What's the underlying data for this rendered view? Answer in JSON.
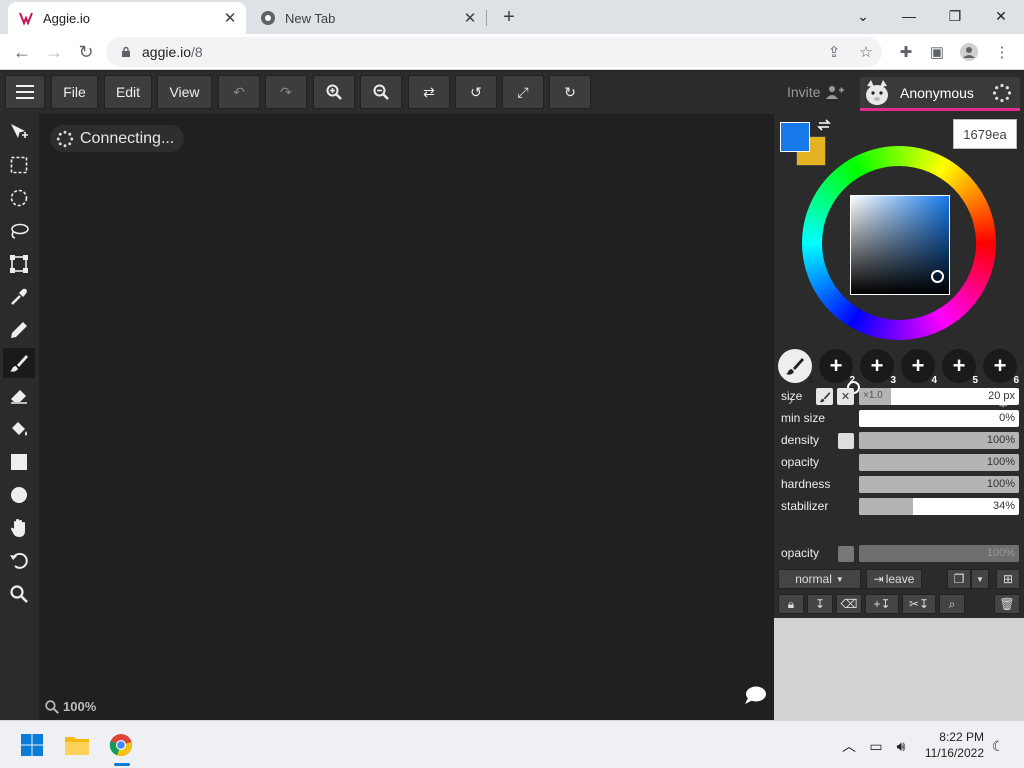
{
  "browser": {
    "tabs": [
      {
        "title": "Aggie.io"
      },
      {
        "title": "New Tab"
      }
    ],
    "url_host": "aggie.io",
    "url_path": "/8"
  },
  "menu": {
    "file": "File",
    "edit": "Edit",
    "view": "View",
    "invite": "Invite",
    "username": "Anonymous"
  },
  "canvas": {
    "status": "Connecting...",
    "zoom": "100%"
  },
  "color": {
    "primary": "#1679ea",
    "secondary": "#e5b321",
    "hex": "1679ea"
  },
  "brushes": [
    "1",
    "2",
    "3",
    "4",
    "5",
    "6"
  ],
  "brush_settings": {
    "size_label": "size",
    "size_multiplier": "×1.0",
    "size_value": "20 px",
    "size_level": 0.2,
    "min_size_label": "min size",
    "min_size_value": "0%",
    "density_label": "density",
    "density_value": "100%",
    "opacity_label": "opacity",
    "opacity_value": "100%",
    "hardness_label": "hardness",
    "hardness_value": "100%",
    "stabilizer_label": "stabilizer",
    "stabilizer_value": "34%"
  },
  "layer": {
    "opacity_label": "opacity",
    "opacity_value": "100%",
    "blend_mode": "normal",
    "leave_label": "leave"
  },
  "taskbar": {
    "time": "8:22 PM",
    "date": "11/16/2022"
  }
}
